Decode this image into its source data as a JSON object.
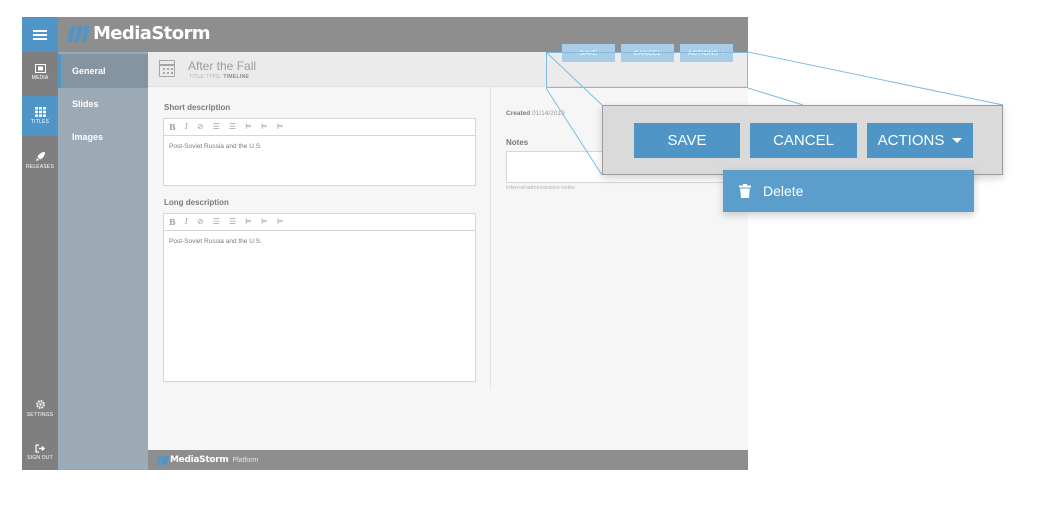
{
  "app": {
    "brand": "MediaStorm",
    "page_title": "After the Fall",
    "title_type_label": "TITLE TYPE:",
    "title_type_value": "TIMELINE"
  },
  "rail": {
    "items": [
      {
        "label": "MEDIA",
        "icon": "film-icon"
      },
      {
        "label": "TITLES",
        "icon": "grid-icon"
      },
      {
        "label": "RELEASES",
        "icon": "rocket-icon"
      },
      {
        "label": "SETTINGS",
        "icon": "gear-icon"
      },
      {
        "label": "SIGN OUT",
        "icon": "sign-out-icon"
      }
    ]
  },
  "subnav": {
    "items": [
      {
        "label": "General"
      },
      {
        "label": "Slides"
      },
      {
        "label": "Images"
      }
    ]
  },
  "toolbar": {
    "save_label": "SAVE",
    "cancel_label": "CANCEL",
    "actions_label": "ACTIONS"
  },
  "form": {
    "short_description_label": "Short description",
    "short_description_value": "Post-Soviet Russia and the U.S.",
    "long_description_label": "Long description",
    "long_description_value": "Post-Soviet Russia and the U.S.",
    "editor_tools": [
      "B",
      "I",
      "⊘",
      "☰",
      "☰",
      "⊨",
      "⊨",
      "⊨"
    ],
    "created_label": "Created",
    "created_value": "01/14/2019",
    "notes_label": "Notes",
    "notes_hint": "Internal/administrative notes"
  },
  "footer": {
    "brand": "MediaStorm",
    "platform": "Platform"
  },
  "callout": {
    "save_label": "SAVE",
    "cancel_label": "CANCEL",
    "actions_label": "ACTIONS",
    "dropdown_items": [
      {
        "label": "Delete",
        "icon": "trash-icon"
      }
    ]
  },
  "colors": {
    "accent": "#4f96c7",
    "accent_light": "#a9cde6",
    "topbar": "#8e8e8e",
    "subnav": "#9caab5"
  }
}
